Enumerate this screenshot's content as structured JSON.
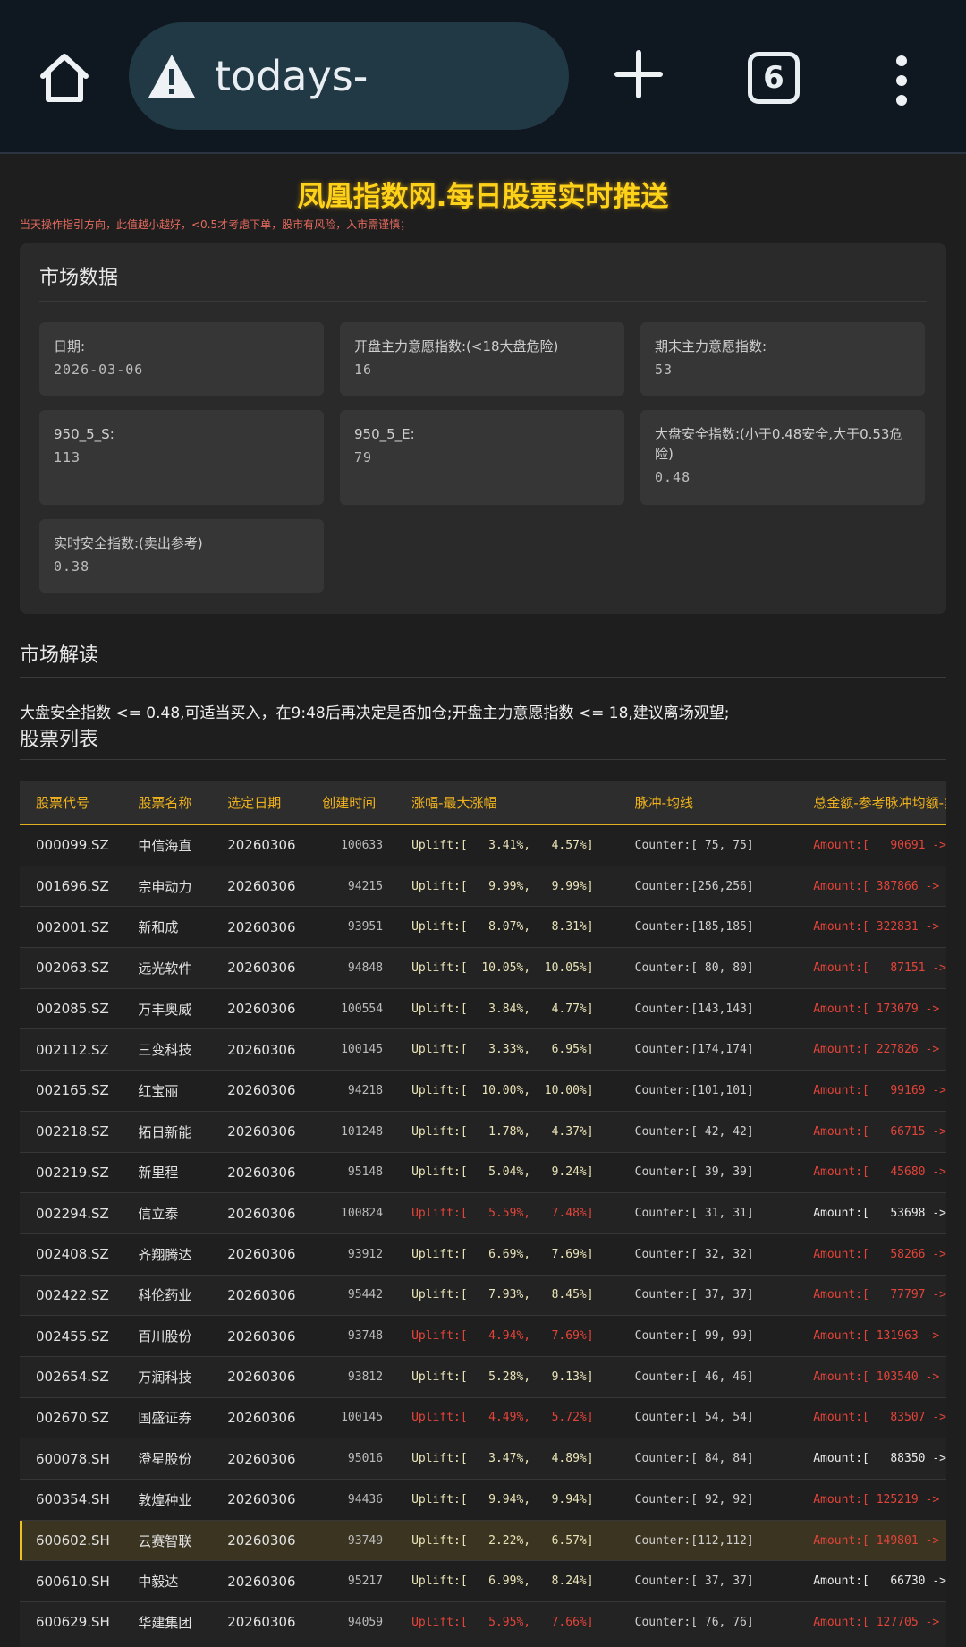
{
  "browser": {
    "url": "todays-stock.com",
    "tab_count": "6"
  },
  "header": {
    "title": "凤凰指数网.每日股票实时推送",
    "warning": "当天操作指引方向，此值越小越好，<0.5才考虑下单，股市有风险，入市需谨慎；"
  },
  "market": {
    "title": "市场数据",
    "metrics": [
      {
        "label": "日期:",
        "value": "2026-03-06"
      },
      {
        "label": "开盘主力意愿指数:(<18大盘危险)",
        "value": "16"
      },
      {
        "label": "期末主力意愿指数:",
        "value": "53"
      },
      {
        "label": "950_5_S:",
        "value": "113"
      },
      {
        "label": "950_5_E:",
        "value": "79"
      },
      {
        "label": "大盘安全指数:(小于0.48安全,大于0.53危险)",
        "value": "0.48"
      },
      {
        "label": "实时安全指数:(卖出参考)",
        "value": "0.38"
      }
    ]
  },
  "analysis": {
    "title": "市场解读",
    "text": "大盘安全指数 <= 0.48,可适当买入，在9:48后再决定是否加仓;开盘主力意愿指数 <= 18,建议离场观望;"
  },
  "stocks": {
    "title": "股票列表",
    "headers": [
      "股票代号",
      "股票名称",
      "选定日期",
      "创建时间",
      "涨幅-最大涨幅",
      "脉冲-均线",
      "总金额-参考脉冲均额-实"
    ],
    "rows": [
      {
        "code": "000099.SZ",
        "name": "中信海直",
        "date": "20260306",
        "time": "100633",
        "uplift": "Uplift:[   3.41%,   4.57%]",
        "counter": "Counter:[ 75, 75]",
        "amount": "Amount:[   90691 ->",
        "up_red": false,
        "amt_red": true
      },
      {
        "code": "001696.SZ",
        "name": "宗申动力",
        "date": "20260306",
        "time": "94215",
        "uplift": "Uplift:[   9.99%,   9.99%]",
        "counter": "Counter:[256,256]",
        "amount": "Amount:[ 387866 ->",
        "up_red": false,
        "amt_red": true
      },
      {
        "code": "002001.SZ",
        "name": "新和成",
        "date": "20260306",
        "time": "93951",
        "uplift": "Uplift:[   8.07%,   8.31%]",
        "counter": "Counter:[185,185]",
        "amount": "Amount:[ 322831 ->",
        "up_red": false,
        "amt_red": true
      },
      {
        "code": "002063.SZ",
        "name": "远光软件",
        "date": "20260306",
        "time": "94848",
        "uplift": "Uplift:[  10.05%,  10.05%]",
        "counter": "Counter:[ 80, 80]",
        "amount": "Amount:[   87151 ->",
        "up_red": false,
        "amt_red": true
      },
      {
        "code": "002085.SZ",
        "name": "万丰奥威",
        "date": "20260306",
        "time": "100554",
        "uplift": "Uplift:[   3.84%,   4.77%]",
        "counter": "Counter:[143,143]",
        "amount": "Amount:[ 173079 ->",
        "up_red": false,
        "amt_red": true
      },
      {
        "code": "002112.SZ",
        "name": "三变科技",
        "date": "20260306",
        "time": "100145",
        "uplift": "Uplift:[   3.33%,   6.95%]",
        "counter": "Counter:[174,174]",
        "amount": "Amount:[ 227826 ->",
        "up_red": false,
        "amt_red": true
      },
      {
        "code": "002165.SZ",
        "name": "红宝丽",
        "date": "20260306",
        "time": "94218",
        "uplift": "Uplift:[  10.00%,  10.00%]",
        "counter": "Counter:[101,101]",
        "amount": "Amount:[   99169 ->",
        "up_red": false,
        "amt_red": true
      },
      {
        "code": "002218.SZ",
        "name": "拓日新能",
        "date": "20260306",
        "time": "101248",
        "uplift": "Uplift:[   1.78%,   4.37%]",
        "counter": "Counter:[ 42, 42]",
        "amount": "Amount:[   66715 ->",
        "up_red": false,
        "amt_red": true
      },
      {
        "code": "002219.SZ",
        "name": "新里程",
        "date": "20260306",
        "time": "95148",
        "uplift": "Uplift:[   5.04%,   9.24%]",
        "counter": "Counter:[ 39, 39]",
        "amount": "Amount:[   45680 ->",
        "up_red": false,
        "amt_red": true
      },
      {
        "code": "002294.SZ",
        "name": "信立泰",
        "date": "20260306",
        "time": "100824",
        "uplift": "Uplift:[   5.59%,   7.48%]",
        "counter": "Counter:[ 31, 31]",
        "amount": "Amount:[   53698 ->",
        "up_red": true,
        "amt_red": false
      },
      {
        "code": "002408.SZ",
        "name": "齐翔腾达",
        "date": "20260306",
        "time": "93912",
        "uplift": "Uplift:[   6.69%,   7.69%]",
        "counter": "Counter:[ 32, 32]",
        "amount": "Amount:[   58266 ->",
        "up_red": false,
        "amt_red": true
      },
      {
        "code": "002422.SZ",
        "name": "科伦药业",
        "date": "20260306",
        "time": "95442",
        "uplift": "Uplift:[   7.93%,   8.45%]",
        "counter": "Counter:[ 37, 37]",
        "amount": "Amount:[   77797 ->",
        "up_red": false,
        "amt_red": true
      },
      {
        "code": "002455.SZ",
        "name": "百川股份",
        "date": "20260306",
        "time": "93748",
        "uplift": "Uplift:[   4.94%,   7.69%]",
        "counter": "Counter:[ 99, 99]",
        "amount": "Amount:[ 131963 ->",
        "up_red": true,
        "amt_red": true
      },
      {
        "code": "002654.SZ",
        "name": "万润科技",
        "date": "20260306",
        "time": "93812",
        "uplift": "Uplift:[   5.28%,   9.13%]",
        "counter": "Counter:[ 46, 46]",
        "amount": "Amount:[ 103540 ->",
        "up_red": false,
        "amt_red": true
      },
      {
        "code": "002670.SZ",
        "name": "国盛证券",
        "date": "20260306",
        "time": "100145",
        "uplift": "Uplift:[   4.49%,   5.72%]",
        "counter": "Counter:[ 54, 54]",
        "amount": "Amount:[   83507 ->",
        "up_red": true,
        "amt_red": true
      },
      {
        "code": "600078.SH",
        "name": "澄星股份",
        "date": "20260306",
        "time": "95016",
        "uplift": "Uplift:[   3.47%,   4.89%]",
        "counter": "Counter:[ 84, 84]",
        "amount": "Amount:[   88350 ->",
        "up_red": false,
        "amt_red": false
      },
      {
        "code": "600354.SH",
        "name": "敦煌种业",
        "date": "20260306",
        "time": "94436",
        "uplift": "Uplift:[   9.94%,   9.94%]",
        "counter": "Counter:[ 92, 92]",
        "amount": "Amount:[ 125219 ->",
        "up_red": false,
        "amt_red": true
      },
      {
        "code": "600602.SH",
        "name": "云赛智联",
        "date": "20260306",
        "time": "93749",
        "uplift": "Uplift:[   2.22%,   6.57%]",
        "counter": "Counter:[112,112]",
        "amount": "Amount:[ 149801 ->",
        "up_red": false,
        "amt_red": true,
        "highlight": true
      },
      {
        "code": "600610.SH",
        "name": "中毅达",
        "date": "20260306",
        "time": "95217",
        "uplift": "Uplift:[   6.99%,   8.24%]",
        "counter": "Counter:[ 37, 37]",
        "amount": "Amount:[   66730 ->",
        "up_red": false,
        "amt_red": false
      },
      {
        "code": "600629.SH",
        "name": "华建集团",
        "date": "20260306",
        "time": "94059",
        "uplift": "Uplift:[   5.95%,   7.66%]",
        "counter": "Counter:[ 76, 76]",
        "amount": "Amount:[ 127705 ->",
        "up_red": true,
        "amt_red": true
      }
    ]
  }
}
